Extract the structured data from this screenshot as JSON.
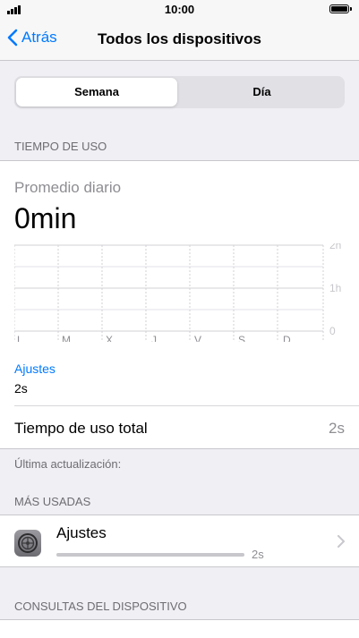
{
  "status_bar": {
    "time": "10:00"
  },
  "nav": {
    "back_label": "Atrás",
    "title": "Todos los dispositivos"
  },
  "segmented": {
    "options": [
      "Semana",
      "Día"
    ],
    "selected": "Semana"
  },
  "screen_time": {
    "header": "TIEMPO DE USO",
    "average_label": "Promedio diario",
    "average_value": "0min",
    "chart_y_labels": [
      "2h",
      "1h",
      "0"
    ],
    "chart_days": [
      "L",
      "M",
      "X",
      "J",
      "V",
      "S",
      "D"
    ],
    "category_label": "Ajustes",
    "category_value": "2s",
    "total_label": "Tiempo de uso total",
    "total_value": "2s"
  },
  "last_update": "Última actualización:",
  "most_used": {
    "header": "MÁS USADAS",
    "items": [
      {
        "name": "Ajustes",
        "time": "2s",
        "usage_fraction": 1.0,
        "icon": "settings-gear-icon"
      }
    ]
  },
  "device_queries": {
    "header": "CONSULTAS DEL DISPOSITIVO"
  },
  "colors": {
    "accent": "#007aff",
    "background": "#efeff4",
    "secondary_text": "#8e8e93"
  }
}
